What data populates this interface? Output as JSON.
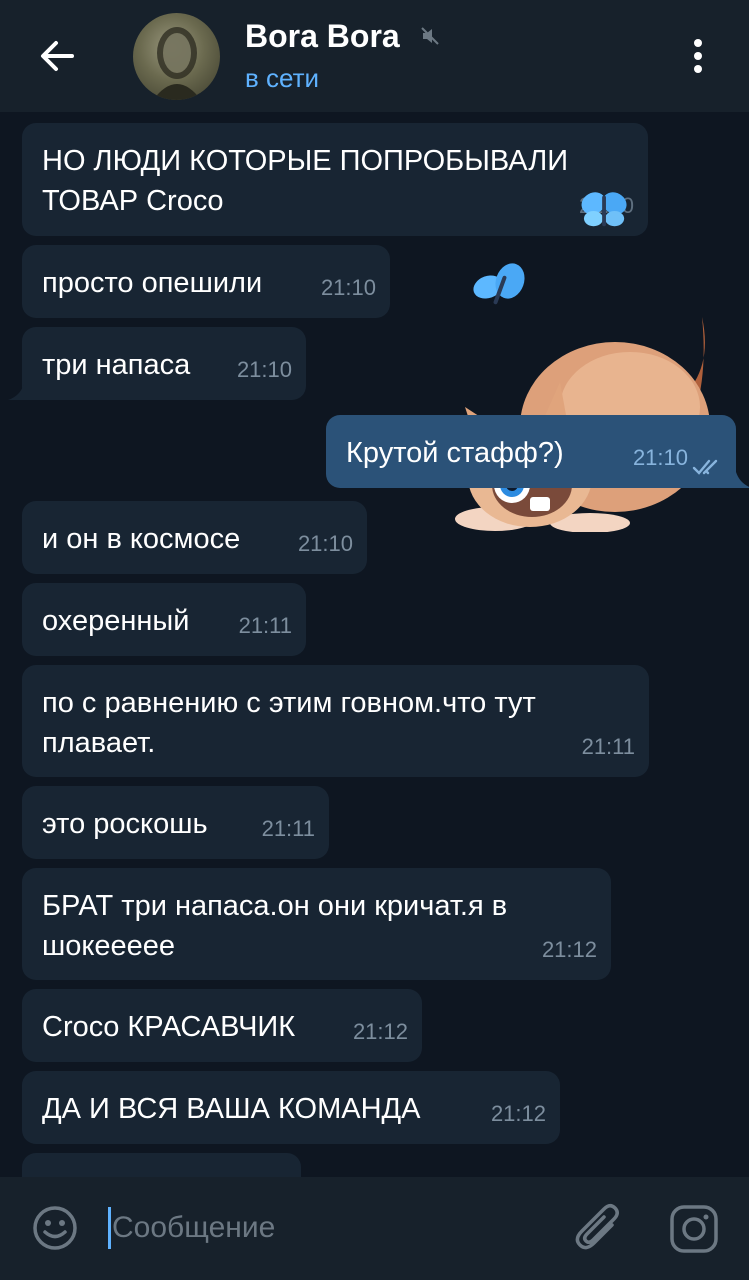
{
  "header": {
    "contact_name": "Bora Bora",
    "status": "в сети"
  },
  "messages": [
    {
      "text": "НО ЛЮДИ КОТОРЫЕ ПОПРОБЫВАЛИ\nТОВАР Croco",
      "time": "21:10"
    },
    {
      "text": "просто опешили",
      "time": "21:10"
    },
    {
      "text": "три напаса",
      "time": "21:10"
    },
    {
      "text": "Крутой стафф?)",
      "time": "21:10"
    },
    {
      "text": "и он в космосе",
      "time": "21:10"
    },
    {
      "text": "охеренный",
      "time": "21:11"
    },
    {
      "text": "по с равнению с этим говном.что тут\nплавает.",
      "time": "21:11"
    },
    {
      "text": "это роскошь",
      "time": "21:11"
    },
    {
      "text": "БРАТ три напаса.он они кричат.я в\nшокеееее",
      "time": "21:12"
    },
    {
      "text": "Croco КРАСАВЧИК",
      "time": "21:12"
    },
    {
      "text": "ДА И ВСЯ ВАША КОМАНДА",
      "time": "21:12"
    }
  ],
  "composer": {
    "placeholder": "Сообщение"
  },
  "colors": {
    "background": "#0e1621",
    "header": "#17212b",
    "incoming_bubble": "#182533",
    "outgoing_bubble": "#2b5278",
    "accent": "#5fb2ff"
  },
  "icons": [
    "back-arrow-icon",
    "mute-icon",
    "more-vertical-icon",
    "butterfly-icon",
    "double-check-icon",
    "emoji-icon",
    "paperclip-icon",
    "instagram-camera-icon"
  ]
}
